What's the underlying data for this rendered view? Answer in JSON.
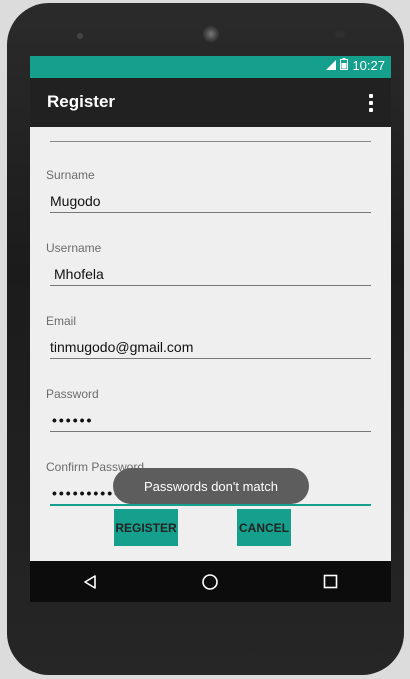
{
  "statusbar": {
    "time": "10:27",
    "signal_icon": "signal-icon",
    "battery_icon": "battery-icon"
  },
  "appbar": {
    "title": "Register",
    "menu_icon": "overflow-menu-icon"
  },
  "form": {
    "surname": {
      "label": "Surname",
      "value": "Mugodo"
    },
    "username": {
      "label": "Username",
      "value": "Mhofela"
    },
    "email": {
      "label": "Email",
      "value": "tinmugodo@gmail.com"
    },
    "password": {
      "label": "Password",
      "value": "••••••"
    },
    "confirm_password": {
      "label": "Confirm Password",
      "value": "••••••••••"
    }
  },
  "buttons": {
    "register": "REGISTER",
    "cancel": "CANCEL"
  },
  "toast": "Passwords don't match",
  "navbar": {
    "back_icon": "back-icon",
    "home_icon": "home-icon",
    "recents_icon": "recents-icon"
  },
  "colors": {
    "accent": "#15a08e",
    "appbar": "#212121",
    "background": "#efefef"
  }
}
